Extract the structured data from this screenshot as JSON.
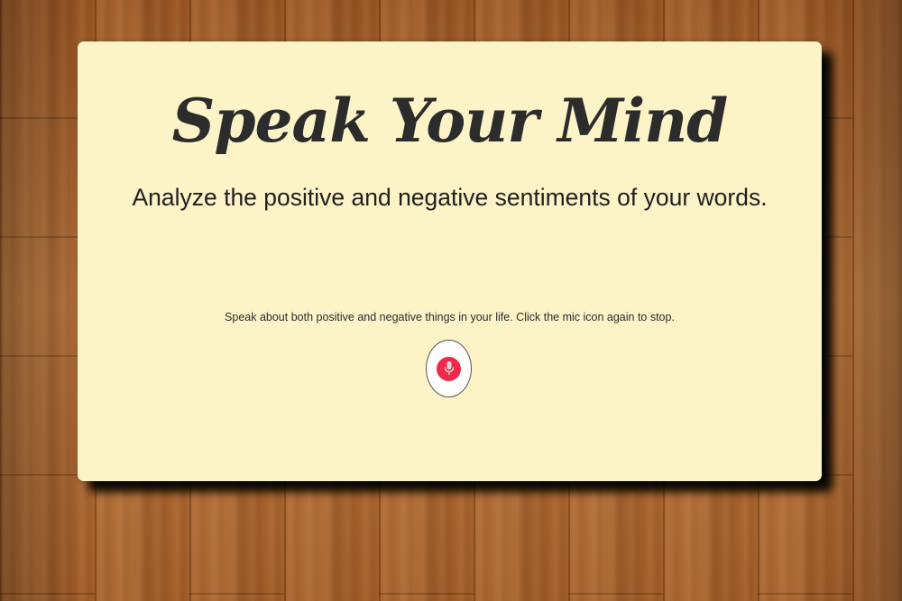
{
  "header": {
    "title": "Speak Your Mind",
    "subtitle": "Analyze the positive and negative sentiments of your words."
  },
  "main": {
    "instructions": "Speak about both positive and negative things in your life. Click the mic icon again to stop.",
    "mic_button": {
      "icon": "microphone-icon",
      "state": "idle"
    }
  },
  "colors": {
    "card_background": "#fcf3c7",
    "mic_accent": "#f0284a",
    "title_text": "#2c2c2c"
  }
}
